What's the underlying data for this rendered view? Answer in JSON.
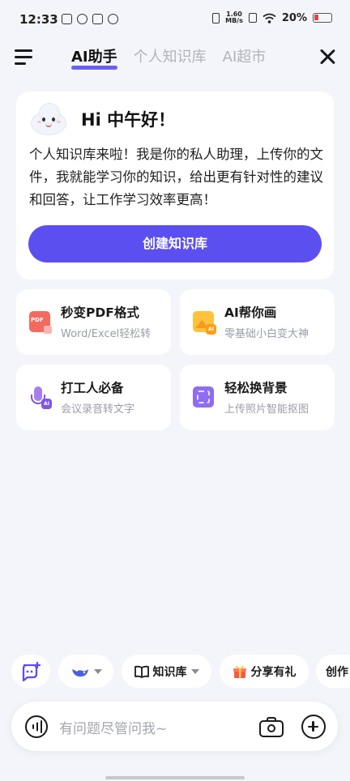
{
  "status_bar": {
    "time": "12:33",
    "speed_value": "1.60",
    "speed_unit": "MB/s",
    "battery": "20%"
  },
  "header": {
    "tabs": [
      {
        "label": "AI助手",
        "active": true
      },
      {
        "label": "个人知识库",
        "active": false
      },
      {
        "label": "AI超市",
        "active": false
      }
    ]
  },
  "hero": {
    "greeting": "Hi 中午好！",
    "description": "个人知识库来啦！我是你的私人助理，上传你的文件，我就能学习你的知识，给出更有针对性的建议和回答，让工作学习效率更高！",
    "button_label": "创建知识库"
  },
  "features": [
    {
      "title": "秒变PDF格式",
      "subtitle": "Word/Excel轻松转",
      "icon": "pdf-icon"
    },
    {
      "title": "AI帮你画",
      "subtitle": "零基础小白变大神",
      "icon": "ai-image-icon"
    },
    {
      "title": "打工人必备",
      "subtitle": "会议录音转文字",
      "icon": "microphone-icon"
    },
    {
      "title": "轻松换背景",
      "subtitle": "上传照片智能抠图",
      "icon": "background-icon"
    }
  ],
  "chips": {
    "knowledge_label": "知识库",
    "gift_label": "分享有礼",
    "create_label": "创作"
  },
  "input": {
    "placeholder": "有问题尽管问我~"
  },
  "colors": {
    "accent": "#5b4ff0",
    "background": "#f4f5fa"
  }
}
